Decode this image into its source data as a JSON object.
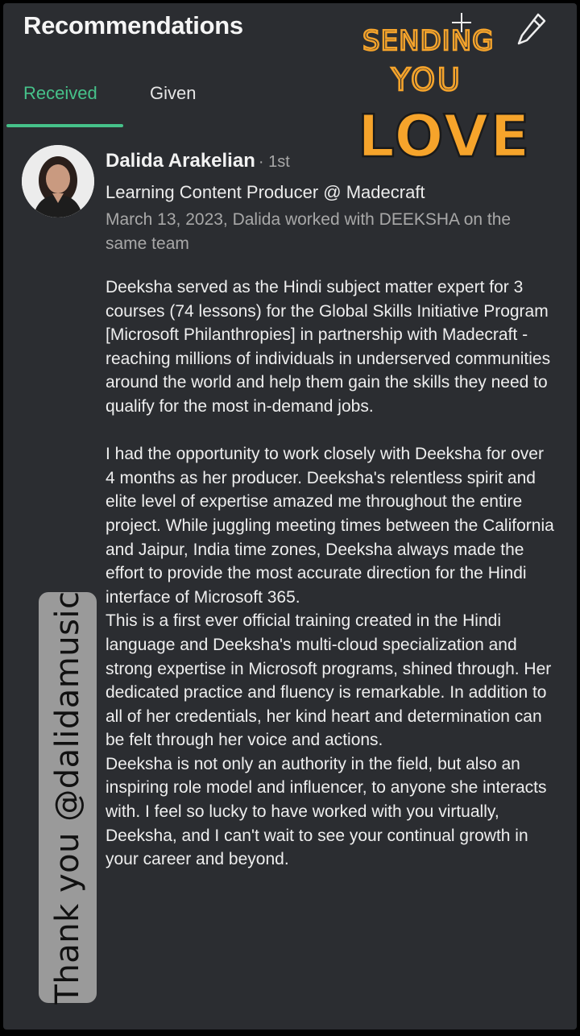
{
  "header": {
    "title": "Recommendations"
  },
  "tabs": [
    {
      "label": "Received",
      "active": true
    },
    {
      "label": "Given",
      "active": false
    }
  ],
  "colors": {
    "background": "#2b2d31",
    "accent": "#46c28a",
    "sticker_orange": "#f6a42b"
  },
  "recommendation": {
    "name": "Dalida Arakelian",
    "degree": "· 1st",
    "headline": "Learning Content Producer @ Madecraft",
    "meta": "March 13, 2023, Dalida worked with DEEKSHA on the same team",
    "paragraphs": [
      "Deeksha served as the Hindi subject matter expert for 3 courses (74 lessons) for the Global Skills Initiative Program [Microsoft Philanthropies] in partnership with Madecraft - reaching millions of individuals in underserved communities around the world and help them gain the skills they need to qualify for the most in-demand jobs.",
      "I had the opportunity to work closely with Deeksha for over 4 months as her producer. Deeksha's relentless spirit and elite level of expertise amazed me throughout the entire project. While juggling meeting times between the California and Jaipur, India time zones, Deeksha always made the effort to provide the most accurate direction for the Hindi interface of Microsoft 365.",
      "This is a first ever official training created in the Hindi language and Deeksha's multi-cloud specialization and strong expertise in Microsoft programs, shined through. Her dedicated practice and fluency is remarkable. In addition to all of her credentials, her kind heart and determination can be felt through her voice and actions.",
      "Deeksha is not only an authority in the field, but also an inspiring role model and influencer, to anyone she interacts with. I feel so lucky to have worked with you virtually, Deeksha, and I can't wait to see your continual growth in your career and beyond."
    ]
  },
  "stickers": {
    "sending_line1": "SENDING",
    "sending_line2": "YOU",
    "sending_line3": "LOVE",
    "thank_you": "Thank you @dalidamusic"
  },
  "icons": {
    "edit": "pencil-icon"
  }
}
